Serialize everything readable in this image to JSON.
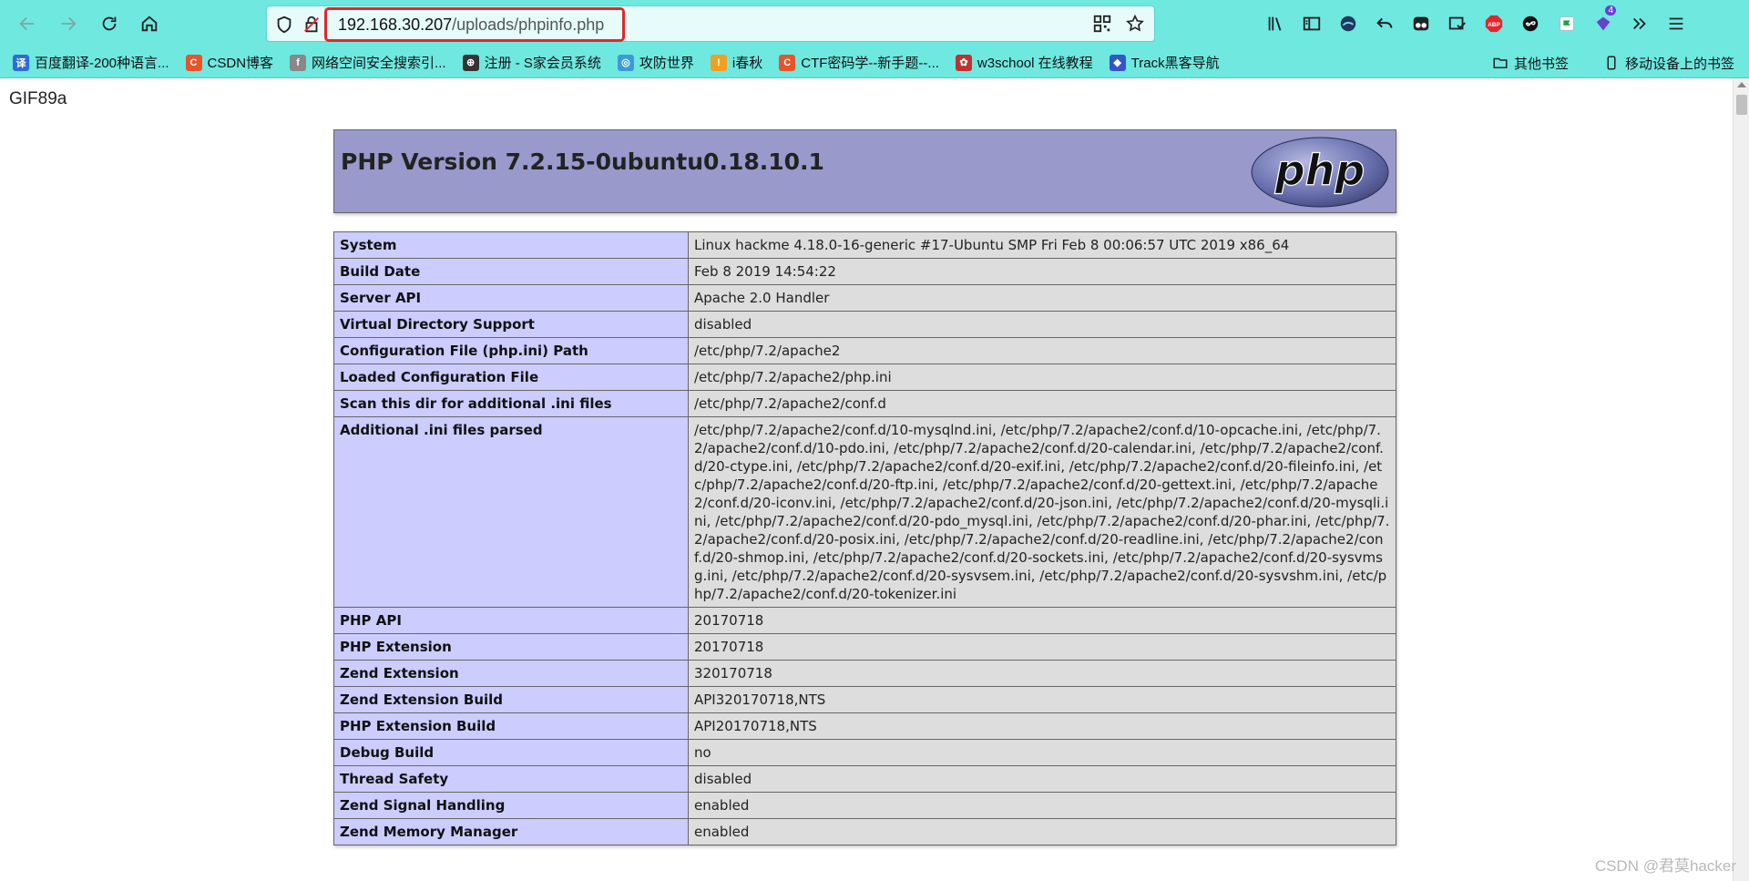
{
  "browser": {
    "url_host": "192.168.30.207",
    "url_path": "/uploads/phpinfo.php",
    "toolbar_badge": "4",
    "abp_label": "ABP"
  },
  "bookmarks": {
    "items": [
      {
        "label": "百度翻译-200种语言...",
        "icon_text": "译",
        "color": "#2e6bd9"
      },
      {
        "label": "CSDN博客",
        "icon_text": "C",
        "color": "#e8532a"
      },
      {
        "label": "网络空间安全搜索引...",
        "icon_text": "f",
        "color": "#888888"
      },
      {
        "label": "注册 - S家会员系统",
        "icon_text": "⊕",
        "color": "#333333"
      },
      {
        "label": "攻防世界",
        "icon_text": "◎",
        "color": "#3a9bd9"
      },
      {
        "label": "i春秋",
        "icon_text": "!",
        "color": "#f0a020"
      },
      {
        "label": "CTF密码学--新手题--...",
        "icon_text": "C",
        "color": "#e8532a"
      },
      {
        "label": "w3school 在线教程",
        "icon_text": "✿",
        "color": "#c23030"
      },
      {
        "label": "Track黑客导航",
        "icon_text": "◆",
        "color": "#3355cc"
      }
    ],
    "other": "其他书签",
    "mobile": "移动设备上的书签"
  },
  "page": {
    "gif_header": "GIF89a",
    "php_title": "PHP Version 7.2.15-0ubuntu0.18.10.1",
    "php_logo_text": "php",
    "rows": [
      {
        "key": "System",
        "value": "Linux hackme 4.18.0-16-generic #17-Ubuntu SMP Fri Feb 8 00:06:57 UTC 2019 x86_64"
      },
      {
        "key": "Build Date",
        "value": "Feb 8 2019 14:54:22"
      },
      {
        "key": "Server API",
        "value": "Apache 2.0 Handler"
      },
      {
        "key": "Virtual Directory Support",
        "value": "disabled"
      },
      {
        "key": "Configuration File (php.ini) Path",
        "value": "/etc/php/7.2/apache2"
      },
      {
        "key": "Loaded Configuration File",
        "value": "/etc/php/7.2/apache2/php.ini"
      },
      {
        "key": "Scan this dir for additional .ini files",
        "value": "/etc/php/7.2/apache2/conf.d"
      },
      {
        "key": "Additional .ini files parsed",
        "value": "/etc/php/7.2/apache2/conf.d/10-mysqlnd.ini, /etc/php/7.2/apache2/conf.d/10-opcache.ini, /etc/php/7.2/apache2/conf.d/10-pdo.ini, /etc/php/7.2/apache2/conf.d/20-calendar.ini, /etc/php/7.2/apache2/conf.d/20-ctype.ini, /etc/php/7.2/apache2/conf.d/20-exif.ini, /etc/php/7.2/apache2/conf.d/20-fileinfo.ini, /etc/php/7.2/apache2/conf.d/20-ftp.ini, /etc/php/7.2/apache2/conf.d/20-gettext.ini, /etc/php/7.2/apache2/conf.d/20-iconv.ini, /etc/php/7.2/apache2/conf.d/20-json.ini, /etc/php/7.2/apache2/conf.d/20-mysqli.ini, /etc/php/7.2/apache2/conf.d/20-pdo_mysql.ini, /etc/php/7.2/apache2/conf.d/20-phar.ini, /etc/php/7.2/apache2/conf.d/20-posix.ini, /etc/php/7.2/apache2/conf.d/20-readline.ini, /etc/php/7.2/apache2/conf.d/20-shmop.ini, /etc/php/7.2/apache2/conf.d/20-sockets.ini, /etc/php/7.2/apache2/conf.d/20-sysvmsg.ini, /etc/php/7.2/apache2/conf.d/20-sysvsem.ini, /etc/php/7.2/apache2/conf.d/20-sysvshm.ini, /etc/php/7.2/apache2/conf.d/20-tokenizer.ini"
      },
      {
        "key": "PHP API",
        "value": "20170718"
      },
      {
        "key": "PHP Extension",
        "value": "20170718"
      },
      {
        "key": "Zend Extension",
        "value": "320170718"
      },
      {
        "key": "Zend Extension Build",
        "value": "API320170718,NTS"
      },
      {
        "key": "PHP Extension Build",
        "value": "API20170718,NTS"
      },
      {
        "key": "Debug Build",
        "value": "no"
      },
      {
        "key": "Thread Safety",
        "value": "disabled"
      },
      {
        "key": "Zend Signal Handling",
        "value": "enabled"
      },
      {
        "key": "Zend Memory Manager",
        "value": "enabled"
      }
    ]
  },
  "watermark": "CSDN @君莫hacker",
  "colors": {
    "toolbar_bg": "#6fe8e0",
    "php_header_bg": "#9999cc",
    "key_cell_bg": "#ccccff",
    "value_cell_bg": "#dddddd",
    "url_highlight": "#e0282b"
  }
}
